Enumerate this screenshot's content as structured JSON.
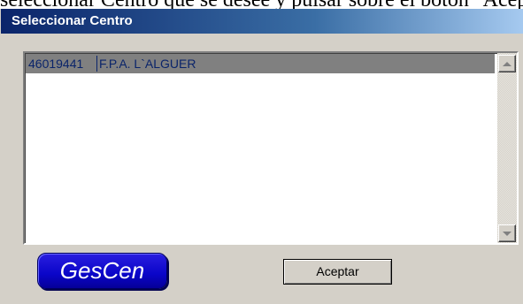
{
  "background": {
    "text": "seleccionar Centro que se desee y pulsar sobre el botón \"Aceptar\"."
  },
  "window": {
    "title": "Seleccionar Centro"
  },
  "list": {
    "items": [
      {
        "code": "46019441",
        "name": "F.P.A. L`ALGUER",
        "selected": true
      }
    ]
  },
  "logo": {
    "text": "GesCen"
  },
  "buttons": {
    "accept_label": "Aceptar"
  },
  "colors": {
    "title_start": "#0a246a",
    "title_end": "#a6caf0",
    "selection_bg": "#808080",
    "selection_text": "#0a246a",
    "logo_bg": "#0a05c8",
    "face": "#d4d0c8"
  },
  "icons": {
    "scroll_up": "scroll-up-arrow-icon",
    "scroll_down": "scroll-down-arrow-icon"
  }
}
